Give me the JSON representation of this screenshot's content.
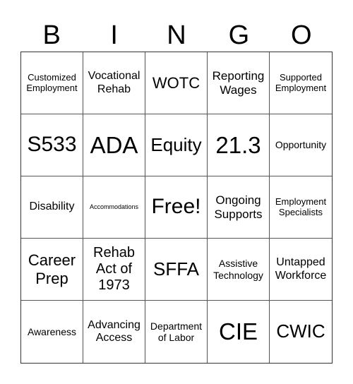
{
  "header": [
    "B",
    "I",
    "N",
    "G",
    "O"
  ],
  "cells": [
    "Customized Employment",
    "Vocational Rehab",
    "WOTC",
    "Reporting Wages",
    "Supported Employment",
    "S533",
    "ADA",
    "Equity",
    "21.3",
    "Opportunity",
    "Disability",
    "Accommodations",
    "Free!",
    "Ongoing Supports",
    "Employment Specialists",
    "Career Prep",
    "Rehab Act of 1973",
    "SFFA",
    "Assistive Technology",
    "Untapped Workforce",
    "Awareness",
    "Advancing Access",
    "Department of Labor",
    "CIE",
    "CWIC"
  ]
}
